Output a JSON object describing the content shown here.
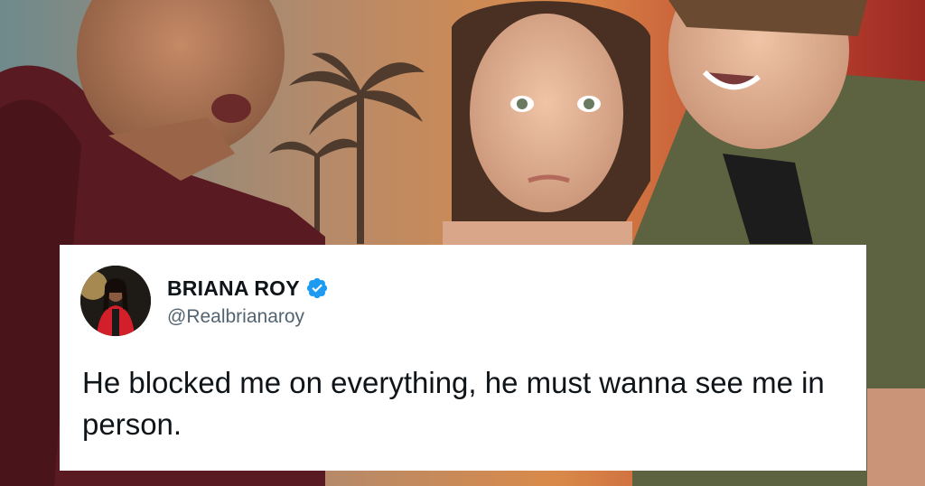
{
  "tweet": {
    "author_name": "BRIANA ROY",
    "author_handle": "@Realbrianaroy",
    "verified": true,
    "text": "He blocked me on everything, he must wanna see me in person.",
    "verified_color": "#1d9bf0"
  },
  "icons": {
    "verified": "verified-badge-icon",
    "avatar": "profile-avatar"
  }
}
